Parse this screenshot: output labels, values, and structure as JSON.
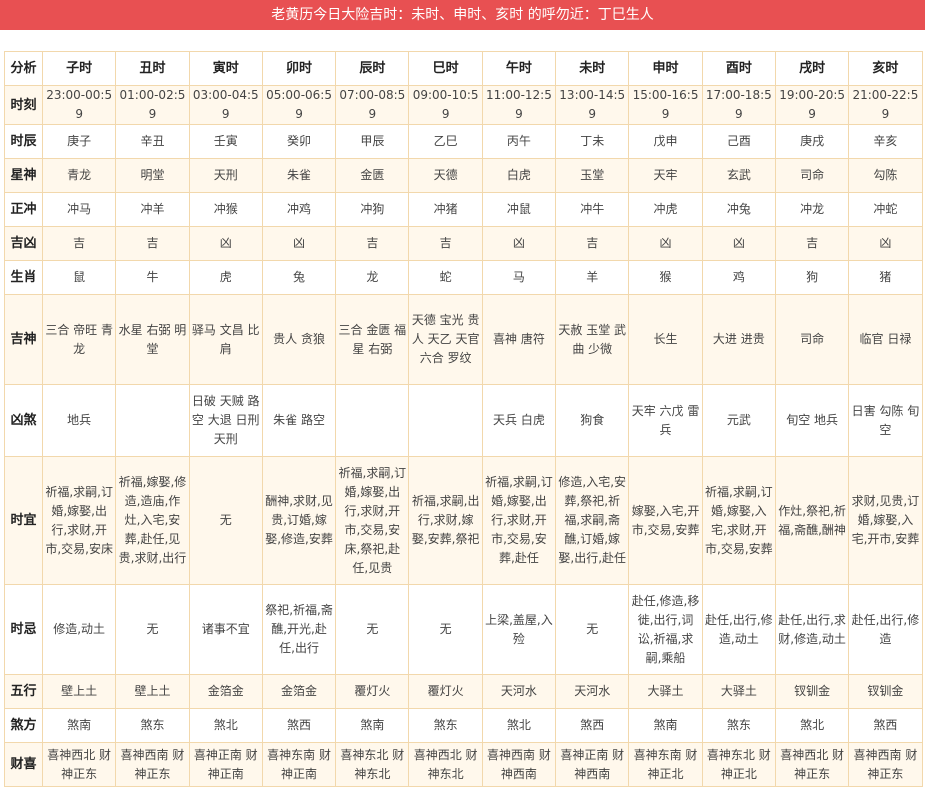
{
  "banner": {
    "text": "老黄历今日大险吉时：未时、申时、亥时 的呼勿近：丁巳生人"
  },
  "table": {
    "header": {
      "label": "分析",
      "cells": [
        "子时",
        "丑时",
        "寅时",
        "卯时",
        "辰时",
        "巳时",
        "午时",
        "未时",
        "申时",
        "酉时",
        "戌时",
        "亥时"
      ]
    },
    "rows": [
      {
        "label": "时刻",
        "cells": [
          "23:00-00:59",
          "01:00-02:59",
          "03:00-04:59",
          "05:00-06:59",
          "07:00-08:59",
          "09:00-10:59",
          "11:00-12:59",
          "13:00-14:59",
          "15:00-16:59",
          "17:00-18:59",
          "19:00-20:59",
          "21:00-22:59"
        ]
      },
      {
        "label": "时辰",
        "cells": [
          "庚子",
          "辛丑",
          "壬寅",
          "癸卯",
          "甲辰",
          "乙巳",
          "丙午",
          "丁未",
          "戊申",
          "己酉",
          "庚戌",
          "辛亥"
        ]
      },
      {
        "label": "星神",
        "cells": [
          "青龙",
          "明堂",
          "天刑",
          "朱雀",
          "金匮",
          "天德",
          "白虎",
          "玉堂",
          "天牢",
          "玄武",
          "司命",
          "勾陈"
        ]
      },
      {
        "label": "正冲",
        "cells": [
          "冲马",
          "冲羊",
          "冲猴",
          "冲鸡",
          "冲狗",
          "冲猪",
          "冲鼠",
          "冲牛",
          "冲虎",
          "冲兔",
          "冲龙",
          "冲蛇"
        ]
      },
      {
        "label": "吉凶",
        "cells": [
          "吉",
          "吉",
          "凶",
          "凶",
          "吉",
          "吉",
          "凶",
          "吉",
          "凶",
          "凶",
          "吉",
          "凶"
        ]
      },
      {
        "label": "生肖",
        "cells": [
          "鼠",
          "牛",
          "虎",
          "兔",
          "龙",
          "蛇",
          "马",
          "羊",
          "猴",
          "鸡",
          "狗",
          "猪"
        ]
      },
      {
        "label": "吉神",
        "cells": [
          "三合 帝旺 青龙",
          "水星 右弼 明堂",
          "驿马 文昌 比肩",
          "贵人 贪狼",
          "三合 金匮 福星 右弼",
          "天德 宝光 贵人 天乙 天官 六合 罗纹",
          "喜神 唐符",
          "天赦 玉堂 武曲 少微",
          "长生",
          "大进 进贵",
          "司命",
          "临官 日禄"
        ]
      },
      {
        "label": "凶煞",
        "cells": [
          "地兵",
          "",
          "日破 天贼 路空 大退 日刑 天刑",
          "朱雀 路空",
          "",
          "",
          "天兵 白虎",
          "狗食",
          "天牢 六戊 雷兵",
          "元武",
          "旬空 地兵",
          "日害 勾陈 旬空"
        ]
      },
      {
        "label": "时宜",
        "cells": [
          "祈福,求嗣,订婚,嫁娶,出行,求财,开市,交易,安床",
          "祈福,嫁娶,修造,造庙,作灶,入宅,安葬,赴任,见贵,求财,出行",
          "无",
          "酬神,求财,见贵,订婚,嫁娶,修造,安葬",
          "祈福,求嗣,订婚,嫁娶,出行,求财,开市,交易,安床,祭祀,赴任,见贵",
          "祈福,求嗣,出行,求财,嫁娶,安葬,祭祀",
          "祈福,求嗣,订婚,嫁娶,出行,求财,开市,交易,安葬,赴任",
          "修造,入宅,安葬,祭祀,祈福,求嗣,斋醮,订婚,嫁娶,出行,赴任",
          "嫁娶,入宅,开市,交易,安葬",
          "祈福,求嗣,订婚,嫁娶,入宅,求财,开市,交易,安葬",
          "作灶,祭祀,祈福,斋醮,酬神",
          "求财,见贵,订婚,嫁娶,入宅,开市,安葬"
        ]
      },
      {
        "label": "时忌",
        "cells": [
          "修造,动土",
          "无",
          "诸事不宜",
          "祭祀,祈福,斋醮,开光,赴任,出行",
          "无",
          "无",
          "上梁,盖屋,入殓",
          "无",
          "赴任,修造,移徙,出行,词讼,祈福,求嗣,乘船",
          "赴任,出行,修造,动土",
          "赴任,出行,求财,修造,动土",
          "赴任,出行,修造"
        ]
      },
      {
        "label": "五行",
        "cells": [
          "壁上土",
          "壁上土",
          "金箔金",
          "金箔金",
          "覆灯火",
          "覆灯火",
          "天河水",
          "天河水",
          "大驿土",
          "大驿土",
          "钗钏金",
          "钗钏金"
        ]
      },
      {
        "label": "煞方",
        "cells": [
          "煞南",
          "煞东",
          "煞北",
          "煞西",
          "煞南",
          "煞东",
          "煞北",
          "煞西",
          "煞南",
          "煞东",
          "煞北",
          "煞西"
        ]
      },
      {
        "label": "财喜",
        "cells": [
          "喜神西北 财神正东",
          "喜神西南 财神正东",
          "喜神正南 财神正南",
          "喜神东南 财神正南",
          "喜神东北 财神东北",
          "喜神西北 财神东北",
          "喜神西南 财神西南",
          "喜神正南 财神西南",
          "喜神东南 财神正北",
          "喜神东北 财神正北",
          "喜神西北 财神正东",
          "喜神西南 财神正东"
        ]
      }
    ]
  }
}
